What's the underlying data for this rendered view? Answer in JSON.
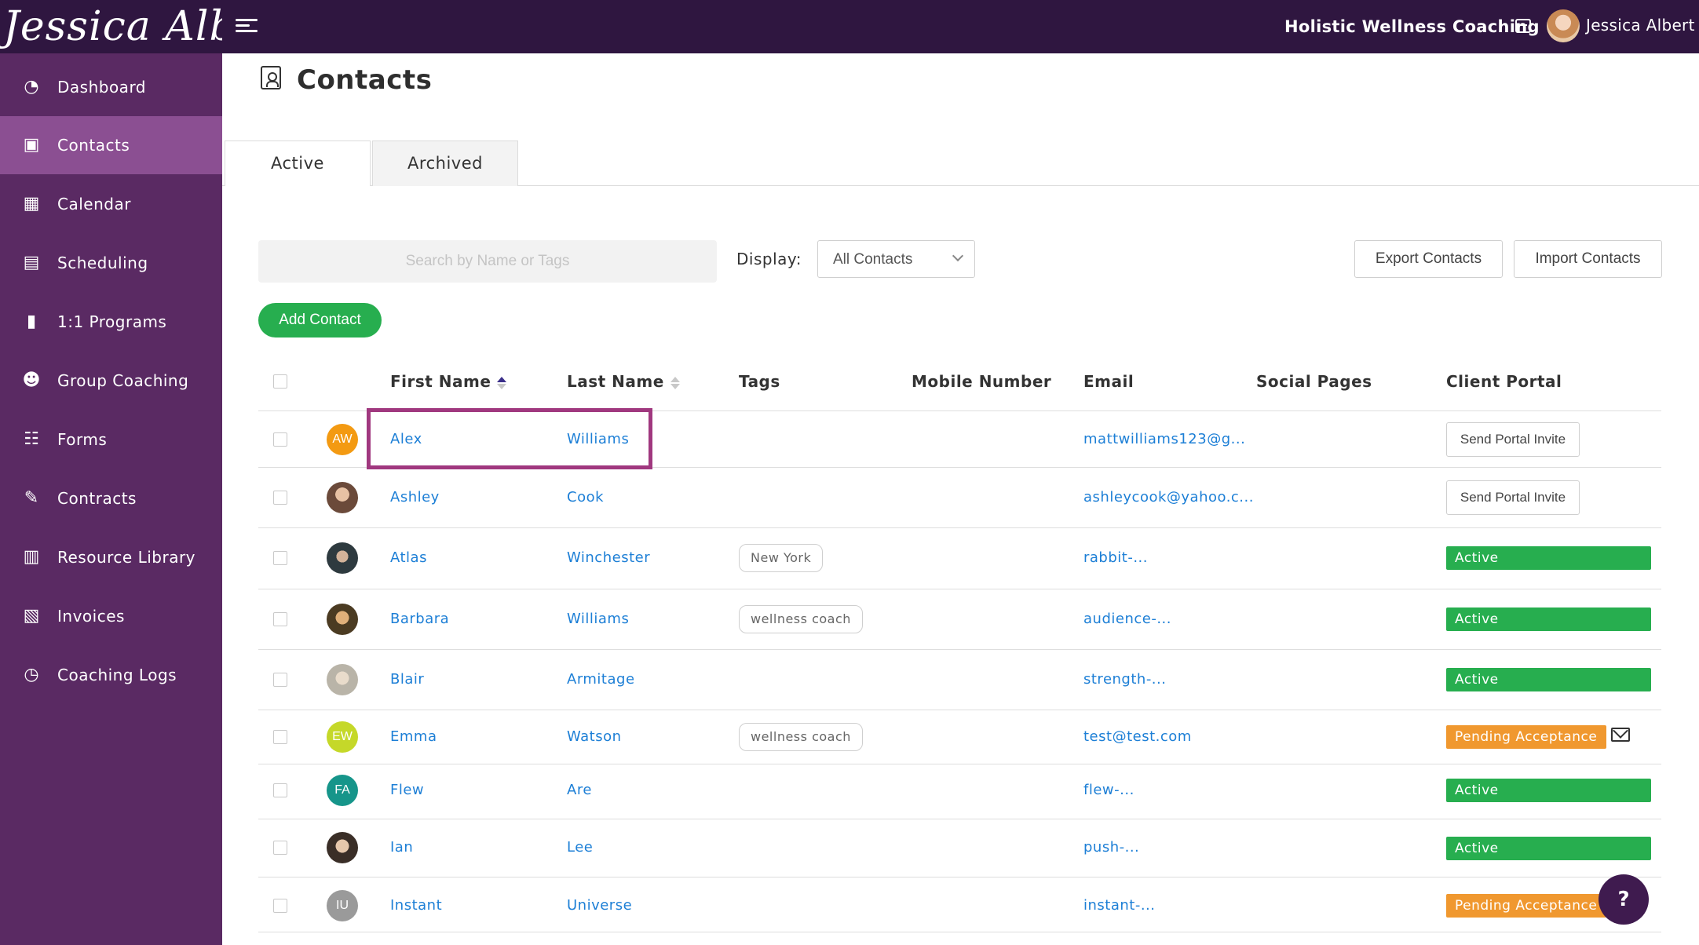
{
  "topbar": {
    "logo_text": "Jessica Albert",
    "brand": "Holistic Wellness Coaching",
    "user_name": "Jessica Albert"
  },
  "sidebar": {
    "items": [
      {
        "label": "Dashboard",
        "icon": "dashboard-icon"
      },
      {
        "label": "Contacts",
        "icon": "contacts-icon"
      },
      {
        "label": "Calendar",
        "icon": "calendar-icon"
      },
      {
        "label": "Scheduling",
        "icon": "scheduling-icon"
      },
      {
        "label": "1:1 Programs",
        "icon": "book-icon"
      },
      {
        "label": "Group Coaching",
        "icon": "group-icon"
      },
      {
        "label": "Forms",
        "icon": "checklist-icon"
      },
      {
        "label": "Contracts",
        "icon": "signature-icon"
      },
      {
        "label": "Resource Library",
        "icon": "library-icon"
      },
      {
        "label": "Invoices",
        "icon": "invoice-icon"
      },
      {
        "label": "Coaching Logs",
        "icon": "clock-icon"
      }
    ],
    "active_index": 1
  },
  "page": {
    "title": "Contacts",
    "tabs": [
      {
        "label": "Active"
      },
      {
        "label": "Archived"
      }
    ],
    "search_placeholder": "Search by Name or Tags",
    "display_label": "Display:",
    "display_value": "All Contacts",
    "export_label": "Export Contacts",
    "import_label": "Import Contacts",
    "add_label": "Add Contact"
  },
  "table": {
    "headers": {
      "first_name": "First Name",
      "last_name": "Last Name",
      "tags": "Tags",
      "mobile": "Mobile Number",
      "email": "Email",
      "social": "Social Pages",
      "portal": "Client Portal"
    },
    "rows": [
      {
        "initials": "AW",
        "avatar_color": "#f39a12",
        "first": "Alex",
        "last": "Williams",
        "tag": "",
        "email": "mattwilliams123@g...",
        "portal": "Send Portal Invite",
        "portal_type": "button"
      },
      {
        "initials": "",
        "avatar_color": "#b58a6e",
        "first": "Ashley",
        "last": "Cook",
        "tag": "",
        "email": "ashleycook@yahoo.c...",
        "portal": "Send Portal Invite",
        "portal_type": "button"
      },
      {
        "initials": "",
        "avatar_color": "#3e4a4f",
        "first": "Atlas",
        "last": "Winchester",
        "tag": "New York",
        "email": "rabbit-...",
        "portal": "Active",
        "portal_type": "active"
      },
      {
        "initials": "",
        "avatar_color": "#6a5a3e",
        "first": "Barbara",
        "last": "Williams",
        "tag": "wellness coach",
        "email": "audience-...",
        "portal": "Active",
        "portal_type": "active"
      },
      {
        "initials": "",
        "avatar_color": "#b9b4a8",
        "first": "Blair",
        "last": "Armitage",
        "tag": "",
        "email": "strength-...",
        "portal": "Active",
        "portal_type": "active"
      },
      {
        "initials": "EW",
        "avatar_color": "#c5d829",
        "first": "Emma",
        "last": "Watson",
        "tag": "wellness coach",
        "email": "test@test.com",
        "portal": "Pending Acceptance",
        "portal_type": "pending"
      },
      {
        "initials": "FA",
        "avatar_color": "#16958a",
        "first": "Flew",
        "last": "Are",
        "tag": "",
        "email": "flew-...",
        "portal": "Active",
        "portal_type": "active"
      },
      {
        "initials": "",
        "avatar_color": "#6e5d50",
        "first": "Ian",
        "last": "Lee",
        "tag": "",
        "email": "push-...",
        "portal": "Active",
        "portal_type": "active"
      },
      {
        "initials": "IU",
        "avatar_color": "#9a9a9a",
        "first": "Instant",
        "last": "Universe",
        "tag": "",
        "email": "instant-...",
        "portal": "Pending Acceptance",
        "portal_type": "pending"
      }
    ]
  },
  "help_label": "?"
}
